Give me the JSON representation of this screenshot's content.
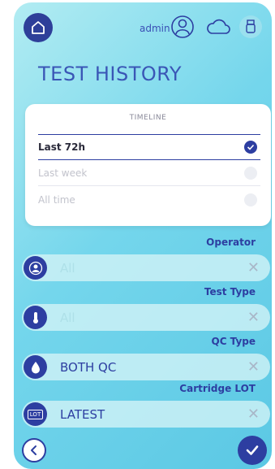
{
  "header": {
    "user": "admin",
    "icons": [
      "home-icon",
      "user-avatar-icon",
      "cloud-icon",
      "usb-icon"
    ]
  },
  "page_title": "TEST HISTORY",
  "timeline": {
    "title": "TIMELINE",
    "options": [
      {
        "label": "Last 72h",
        "selected": true
      },
      {
        "label": "Last week",
        "selected": false
      },
      {
        "label": "All time",
        "selected": false
      }
    ]
  },
  "filters": {
    "operator": {
      "label": "Operator",
      "value": "All",
      "icon": "user-icon"
    },
    "test_type": {
      "label": "Test Type",
      "value": "All",
      "icon": "thermometer-icon"
    },
    "qc_type": {
      "label": "QC Type",
      "value": "BOTH QC",
      "icon": "drop-icon"
    },
    "cartridge_lot": {
      "label": "Cartridge LOT",
      "value": "LATEST",
      "icon": "lot-icon",
      "icon_text": "LOT"
    }
  },
  "clear_glyph": "✕",
  "colors": {
    "primary": "#2d3ea1",
    "background": "#74d6ec",
    "card": "#ffffff"
  }
}
